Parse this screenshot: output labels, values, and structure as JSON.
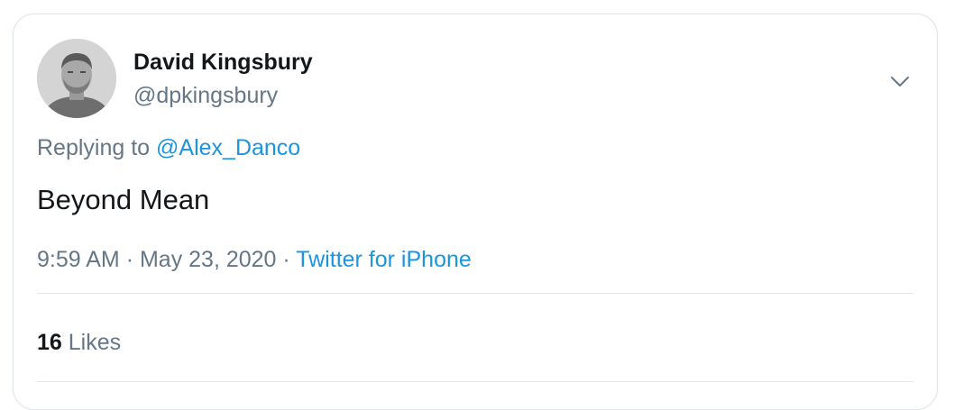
{
  "tweet": {
    "author": {
      "name": "David Kingsbury",
      "handle": "@dpkingsbury"
    },
    "reply": {
      "prefix": "Replying to",
      "mention": "@Alex_Danco"
    },
    "text": "Beyond Mean",
    "meta": {
      "time": "9:59 AM",
      "separator1": "·",
      "date": "May 23, 2020",
      "separator2": "·",
      "source": "Twitter for iPhone"
    },
    "stats": {
      "likes_count": "16",
      "likes_label": "Likes"
    },
    "icons": {
      "menu": "chevron-down-icon"
    },
    "colors": {
      "link": "#1b95e0",
      "secondary_text": "#657786",
      "primary_text": "#14171a",
      "divider": "#e1e8ed"
    }
  }
}
